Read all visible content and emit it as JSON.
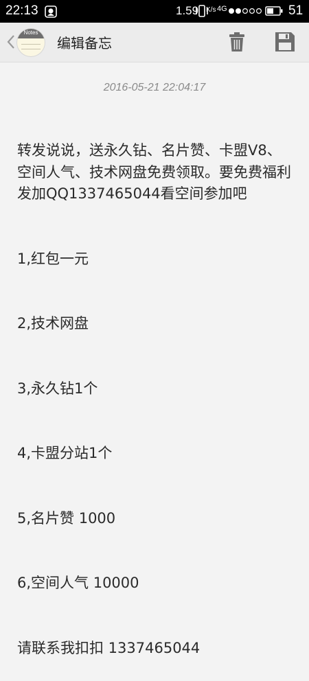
{
  "status_bar": {
    "time": "22:13",
    "network_speed": "1.59",
    "network_speed_unit": "K/s",
    "network_type": "4G",
    "battery_level": "51",
    "icons": [
      "notification-icon",
      "vibrate-icon",
      "signal-icon",
      "battery-icon"
    ]
  },
  "toolbar": {
    "logo_label": "Notes",
    "title": "编辑备忘",
    "actions": [
      "delete-icon",
      "save-icon"
    ]
  },
  "note": {
    "timestamp": "2016-05-21 22:04:17",
    "lines": [
      "转发说说，送永久钻、名片赞、卡盟V8、空间人气、技术网盘免费领取。要免费福利发加QQ1337465044看空间参加吧",
      "1,红包一元",
      "2,技术网盘",
      "3,永久钻1个",
      "4,卡盟分站1个",
      "5,名片赞 1000",
      "6,空间人气 10000",
      "请联系我扣扣 1337465044"
    ]
  },
  "colors": {
    "status_bar_bg": "#000000",
    "toolbar_bg": "#ececec",
    "page_bg": "#f3f3f3",
    "icon_gray": "#6d6d6d"
  }
}
